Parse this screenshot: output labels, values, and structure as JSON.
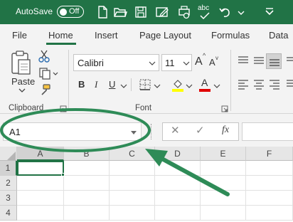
{
  "titlebar": {
    "autosave_label": "AutoSave",
    "autosave_state": "Off",
    "qat_icons": [
      "new-file-icon",
      "open-folder-icon",
      "save-icon",
      "edit-icon",
      "print-preview-icon",
      "spelling-icon",
      "undo-icon",
      "customize-icon"
    ],
    "spelling_glyph": "abc",
    "bg_color": "#217346"
  },
  "tabs": [
    "File",
    "Home",
    "Insert",
    "Page Layout",
    "Formulas",
    "Data"
  ],
  "active_tab": "Home",
  "ribbon": {
    "clipboard": {
      "paste_label": "Paste",
      "group_label": "Clipboard"
    },
    "font": {
      "font_name": "Calibri",
      "font_size": "11",
      "grow_label": "A",
      "shrink_label": "A",
      "bold": "B",
      "italic": "I",
      "underline": "U",
      "font_color_label": "A",
      "highlight_color": "#ffff00",
      "font_color": "#e00000",
      "group_label": "Font"
    }
  },
  "formula_bar": {
    "name_box_value": "A1",
    "cancel_glyph": "✕",
    "enter_glyph": "✓",
    "fx_label": "fx"
  },
  "grid": {
    "columns": [
      "A",
      "B",
      "C",
      "D",
      "E",
      "F"
    ],
    "rows": [
      "1",
      "2",
      "3",
      "4"
    ],
    "active_cell": "A1"
  },
  "annotation": {
    "color": "#2e8b57"
  }
}
